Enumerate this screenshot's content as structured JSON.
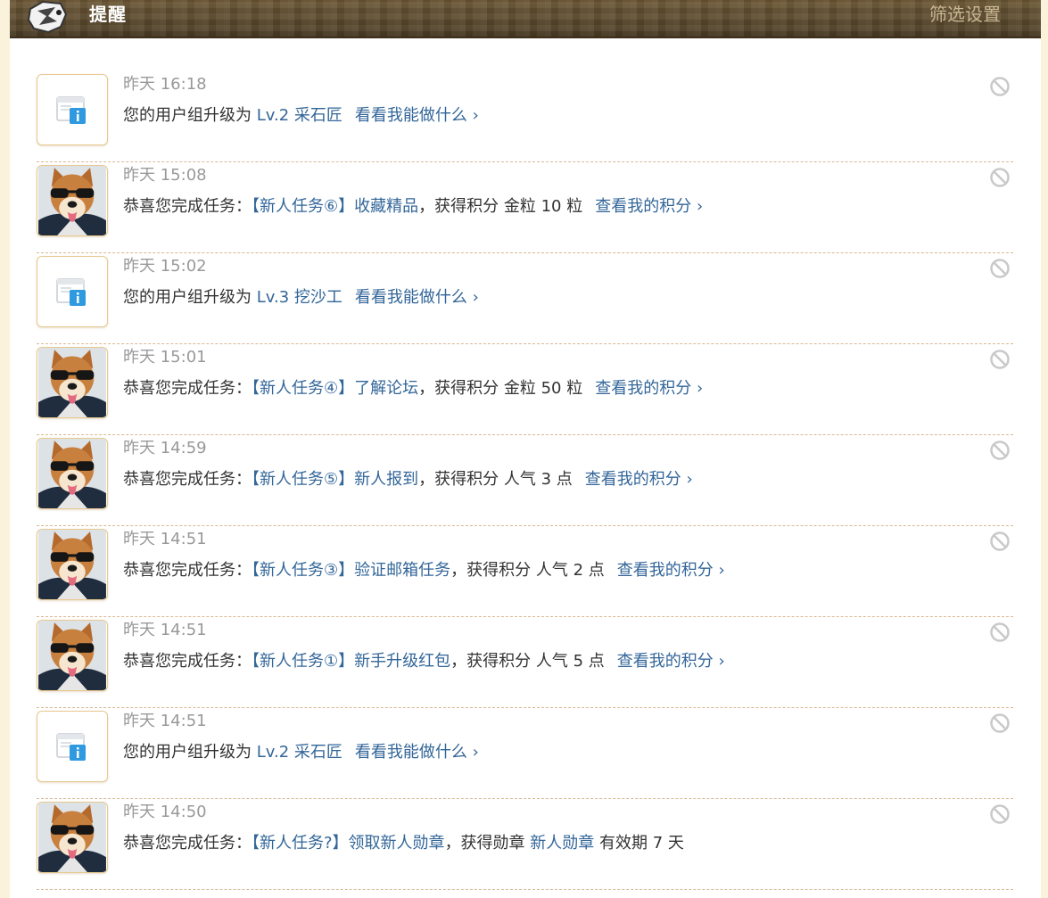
{
  "header": {
    "title": "提醒",
    "filter_label": "筛选设置"
  },
  "notifications": [
    {
      "type": "system",
      "time": "昨天 16:18",
      "text": "您的用户组升级为",
      "link": "Lv.2 采石匠",
      "action": "看看我能做什么 ›"
    },
    {
      "type": "task",
      "time": "昨天 15:08",
      "prefix": "恭喜您完成任务：",
      "task": "【新人任务⑥】收藏精品",
      "reward": "，获得积分 金粒 10 粒",
      "action": "查看我的积分 ›"
    },
    {
      "type": "system",
      "time": "昨天 15:02",
      "text": "您的用户组升级为",
      "link": "Lv.3 挖沙工",
      "action": "看看我能做什么 ›"
    },
    {
      "type": "task",
      "time": "昨天 15:01",
      "prefix": "恭喜您完成任务：",
      "task": "【新人任务④】了解论坛",
      "reward": "，获得积分 金粒 50 粒",
      "action": "查看我的积分 ›"
    },
    {
      "type": "task",
      "time": "昨天 14:59",
      "prefix": "恭喜您完成任务：",
      "task": "【新人任务⑤】新人报到",
      "reward": "，获得积分 人气 3 点",
      "action": "查看我的积分 ›"
    },
    {
      "type": "task",
      "time": "昨天 14:51",
      "prefix": "恭喜您完成任务：",
      "task": "【新人任务③】验证邮箱任务",
      "reward": "，获得积分 人气 2 点",
      "action": "查看我的积分 ›"
    },
    {
      "type": "task",
      "time": "昨天 14:51",
      "prefix": "恭喜您完成任务：",
      "task": "【新人任务①】新手升级红包",
      "reward": "，获得积分 人气 5 点",
      "action": "查看我的积分 ›"
    },
    {
      "type": "system",
      "time": "昨天 14:51",
      "text": "您的用户组升级为",
      "link": "Lv.2 采石匠",
      "action": "看看我能做什么 ›"
    },
    {
      "type": "medal",
      "time": "昨天 14:50",
      "prefix": "恭喜您完成任务：",
      "task": "【新人任务?】领取新人勋章",
      "reward": "，获得勋章",
      "medal": "新人勋章",
      "validity": "有效期 7 天"
    }
  ]
}
